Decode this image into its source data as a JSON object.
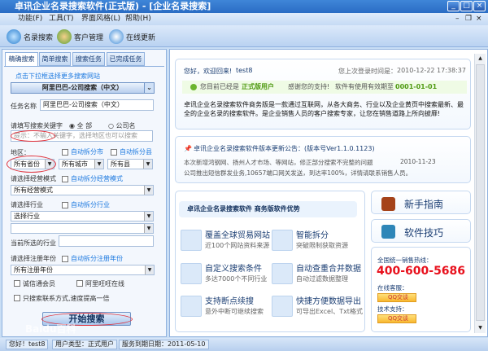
{
  "window": {
    "title": "卓讯企业名录搜索软件(正式版) - [企业名录搜索]"
  },
  "menu": [
    "功能(F)",
    "工具(T)",
    "界面风格(L)",
    "帮助(H)"
  ],
  "toolbar": [
    "名录搜索",
    "客户管理",
    "在线更新"
  ],
  "left": {
    "tabs": [
      "精确搜索",
      "简单搜索",
      "搜索任务",
      "已完成任务"
    ],
    "site_link": "点击下拉框选择更多搜索网站",
    "site_select": "阿里巴巴-公司搜索（中文）",
    "task_label": "任务名称",
    "task_value": "阿里巴巴-公司搜索（中文）",
    "keyword_label": "请填写搜索关键字",
    "radio_all": "全 部",
    "radio_company": "公司名",
    "keyword_placeholder": "提示：不输入关键字，选择地区也可以搜索",
    "region_label": "地区：",
    "auto_city": "自动拆分市",
    "auto_county": "自动拆分县",
    "province": "所有省份",
    "city": "所有城市",
    "county": "所有县",
    "mode_label": "请选择经营模式",
    "auto_mode": "自动拆分经营模式",
    "mode_value": "所有经营模式",
    "industry_label": "请选择行业",
    "auto_industry": "自动拆分行业",
    "industry_value": "选择行业",
    "industry_value2": "",
    "current_industry_label": "当前所选的行业",
    "year_label": "请选择注册年份",
    "auto_year": "自动拆分注册年份",
    "year_value": "所有注册年份",
    "cb_cxt": "诚信通会员",
    "cb_wangwang": "阿里旺旺在线",
    "cb_contact": "只搜索联系方式,速度提高一倍",
    "start": "开始搜索"
  },
  "welcome": {
    "greeting": "您好，欢迎回来!",
    "user": "test8",
    "last_login_label": "您上次登录时间是：",
    "last_login": "2010-12-22 17:38:37",
    "status_prefix": "您目前已经是",
    "status": "正式版用户",
    "thanks": "感谢您的支持!",
    "valid_label": "软件有使用有效期至",
    "valid": "0001-01-01",
    "desc": "卓讯企业名录搜索软件商务版是一款通过互联网，从各大商务、行业以及企业黄页中搜索最新、最全的企业名录的搜索软件。是企业销售人员的客户搜索专家，让您在销售道路上所向披靡!"
  },
  "notice": {
    "title": "卓讯企业名录搜索软件版本更新公告：(版本号Ver1.1.0.1123)",
    "line1": "本次新增鸿钢网、扬州人才市场、等网站，修正部分搜索不完整的问题",
    "date": "2010-11-23",
    "line2": "公司推出短信群发业务,10657端口网关发送，到达率100%，详情请联系销售人员。"
  },
  "advantages": {
    "title": "卓讯企业名录搜索软件  商务版软件优势",
    "items": [
      {
        "t": "覆盖全球贸易网站",
        "s": "近100个网站资料来源"
      },
      {
        "t": "智能拆分",
        "s": "突破限制获取资源"
      },
      {
        "t": "自定义搜索条件",
        "s": "多达7000个不同行业"
      },
      {
        "t": "自动查重合并数据",
        "s": "自动过滤数据整理"
      },
      {
        "t": "支持断点续搜",
        "s": "意外中断可继续搜索"
      },
      {
        "t": "快捷方便数据导出",
        "s": "可导出Excel、Txt格式"
      }
    ]
  },
  "side": {
    "guide": "新手指南",
    "tips": "软件技巧",
    "hotline_label": "全国统一销售热线：",
    "hotline": "400-600-5686",
    "online_label": "在线客服：",
    "tech_label": "技术支持：",
    "qq": "QQ交谈"
  },
  "status": {
    "hello": "您好！test8",
    "type": "用户类型：正式用户",
    "expire": "服务到期日期：2011-05-10"
  },
  "watermark": "Baidu百科"
}
